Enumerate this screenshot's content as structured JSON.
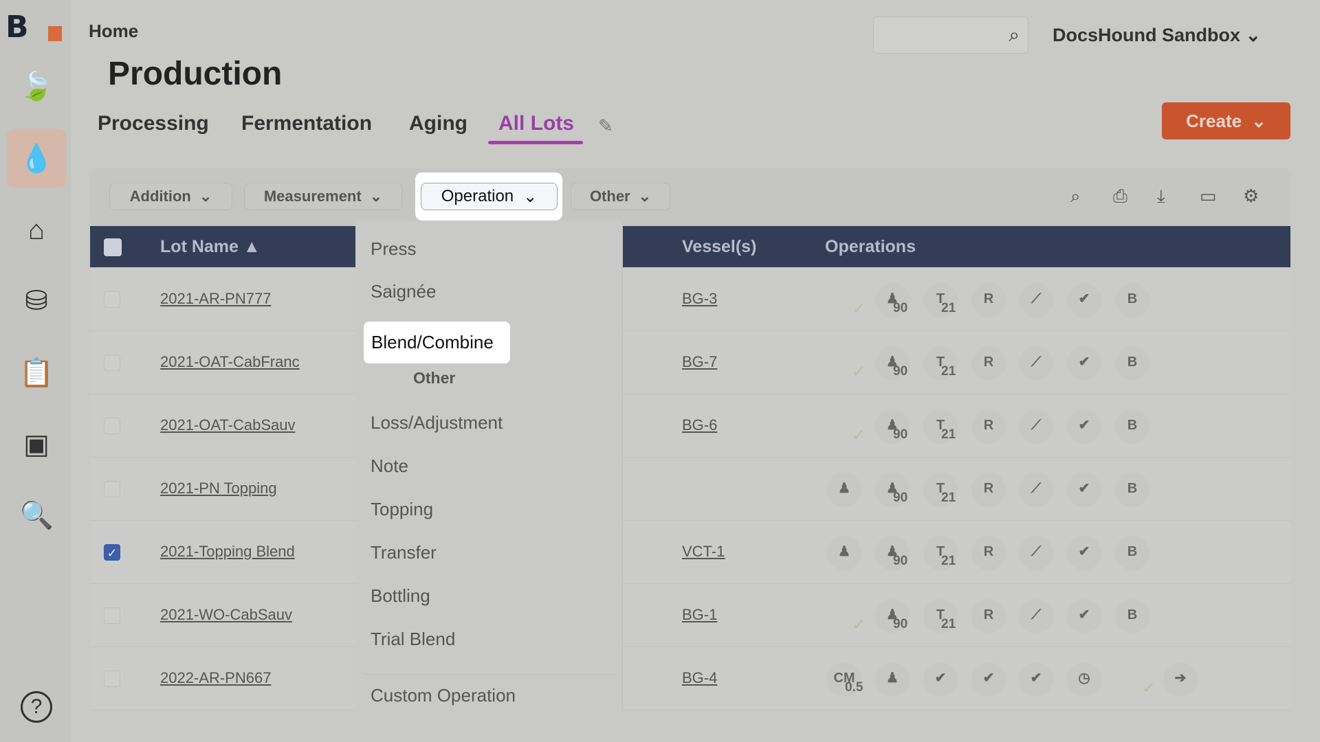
{
  "brand": {
    "logo": "B"
  },
  "sidebar": {
    "items": [
      {
        "icon": "leaf-icon",
        "glyph": "🍃"
      },
      {
        "icon": "drop-icon",
        "glyph": "💧",
        "active": true
      },
      {
        "icon": "warehouse-icon",
        "glyph": "⌂"
      },
      {
        "icon": "basket-icon",
        "glyph": "⛁"
      },
      {
        "icon": "clipboard-check-icon",
        "glyph": "📋"
      },
      {
        "icon": "certificate-icon",
        "glyph": "▣"
      },
      {
        "icon": "dollar-search-icon",
        "glyph": "🔍"
      }
    ],
    "help": {
      "icon": "help-icon",
      "glyph": "?"
    }
  },
  "breadcrumb": "Home",
  "page_title": "Production",
  "tabs": [
    "Processing",
    "Fermentation",
    "Aging",
    "All Lots"
  ],
  "active_tab": "All Lots",
  "org": "DocsHound Sandbox",
  "create_label": "Create",
  "filters": [
    "Addition",
    "Measurement",
    "Operation",
    "Other"
  ],
  "table": {
    "headers": {
      "lot": "Lot Name",
      "vessel": "Vessel(s)",
      "ops": "Operations"
    },
    "rows": [
      {
        "lot": "2021-AR-PN777",
        "vessel": "BG-3",
        "checked": false,
        "ok": true,
        "ops": [
          [
            "",
            ""
          ],
          [
            "♟",
            "90"
          ],
          [
            "T",
            "21"
          ],
          [
            "R",
            ""
          ],
          [
            "⟋",
            ""
          ],
          [
            "✔",
            ""
          ],
          [
            "B",
            ""
          ]
        ]
      },
      {
        "lot": "2021-OAT-CabFranc",
        "vessel": "BG-7",
        "checked": false,
        "ok": true,
        "ops": [
          [
            "",
            ""
          ],
          [
            "♟",
            "90"
          ],
          [
            "T",
            "21"
          ],
          [
            "R",
            ""
          ],
          [
            "⟋",
            ""
          ],
          [
            "✔",
            ""
          ],
          [
            "B",
            ""
          ]
        ]
      },
      {
        "lot": "2021-OAT-CabSauv",
        "vessel": "BG-6",
        "checked": false,
        "ok": true,
        "ops": [
          [
            "",
            ""
          ],
          [
            "♟",
            "90"
          ],
          [
            "T",
            "21"
          ],
          [
            "R",
            ""
          ],
          [
            "⟋",
            ""
          ],
          [
            "✔",
            ""
          ],
          [
            "B",
            ""
          ]
        ]
      },
      {
        "lot": "2021-PN Topping",
        "vessel": "",
        "checked": false,
        "ok": false,
        "ops": [
          [
            "♟",
            ""
          ],
          [
            "♟",
            "90"
          ],
          [
            "T",
            "21"
          ],
          [
            "R",
            ""
          ],
          [
            "⟋",
            ""
          ],
          [
            "✔",
            ""
          ],
          [
            "B",
            ""
          ]
        ]
      },
      {
        "lot": "2021-Topping Blend",
        "vessel": "VCT-1",
        "checked": true,
        "ok": false,
        "ops": [
          [
            "♟",
            ""
          ],
          [
            "♟",
            "90"
          ],
          [
            "T",
            "21"
          ],
          [
            "R",
            ""
          ],
          [
            "⟋",
            ""
          ],
          [
            "✔",
            ""
          ],
          [
            "B",
            ""
          ]
        ]
      },
      {
        "lot": "2021-WO-CabSauv",
        "vessel": "BG-1",
        "checked": false,
        "ok": true,
        "ops": [
          [
            "",
            ""
          ],
          [
            "♟",
            "90"
          ],
          [
            "T",
            "21"
          ],
          [
            "R",
            ""
          ],
          [
            "⟋",
            ""
          ],
          [
            "✔",
            ""
          ],
          [
            "B",
            ""
          ]
        ]
      },
      {
        "lot": "2022-AR-PN667",
        "vessel": "BG-4",
        "checked": false,
        "ok": false,
        "ops": [
          [
            "CM",
            "0.5"
          ],
          [
            "♟",
            ""
          ],
          [
            "✔",
            ""
          ],
          [
            "✔",
            ""
          ],
          [
            "✔",
            ""
          ],
          [
            "◷",
            ""
          ],
          [
            "",
            ""
          ],
          [
            "➔",
            ""
          ]
        ]
      }
    ]
  },
  "dropdown": {
    "items": [
      "Press",
      "Saignée",
      "Blend/Combine",
      "Other",
      "Loss/Adjustment",
      "Note",
      "Topping",
      "Transfer",
      "Bottling",
      "Trial Blend",
      "Custom Operation"
    ],
    "highlighted": "Blend/Combine",
    "group_header": "Other"
  }
}
